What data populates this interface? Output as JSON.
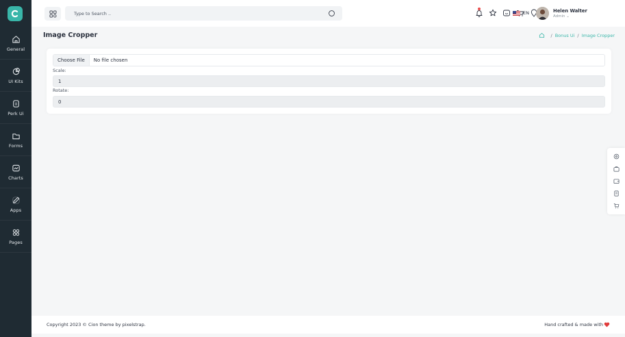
{
  "sidebar": {
    "items": [
      {
        "label": "General",
        "icon": "home-icon"
      },
      {
        "label": "UI Kits",
        "icon": "pie-icon"
      },
      {
        "label": "Perk Ui",
        "icon": "layers-icon"
      },
      {
        "label": "Forms",
        "icon": "folder-icon"
      },
      {
        "label": "Charts",
        "icon": "chart-icon"
      },
      {
        "label": "Apps",
        "icon": "edit-icon"
      },
      {
        "label": "Pages",
        "icon": "grid-icon"
      }
    ]
  },
  "header": {
    "search_placeholder": "Type to Search ..",
    "language": "EN",
    "user_name": "Helen Walter",
    "user_role": "Admin ⌄"
  },
  "page": {
    "title": "Image Cropper",
    "breadcrumb": [
      "Bonus Ui",
      "Image Cropper"
    ]
  },
  "form": {
    "file_button": "Choose File",
    "file_status": "No file chosen",
    "scale_label": "Scale:",
    "scale_value": "1",
    "rotate_label": "Rotate:",
    "rotate_value": "0"
  },
  "footer": {
    "copyright": "Copyright 2023 © Cion theme by pixelstrap.",
    "made": "Hand crafted & made with"
  },
  "colors": {
    "accent": "#39b6a9",
    "sidebar": "#1f2b33",
    "heart": "#e03b3b"
  }
}
